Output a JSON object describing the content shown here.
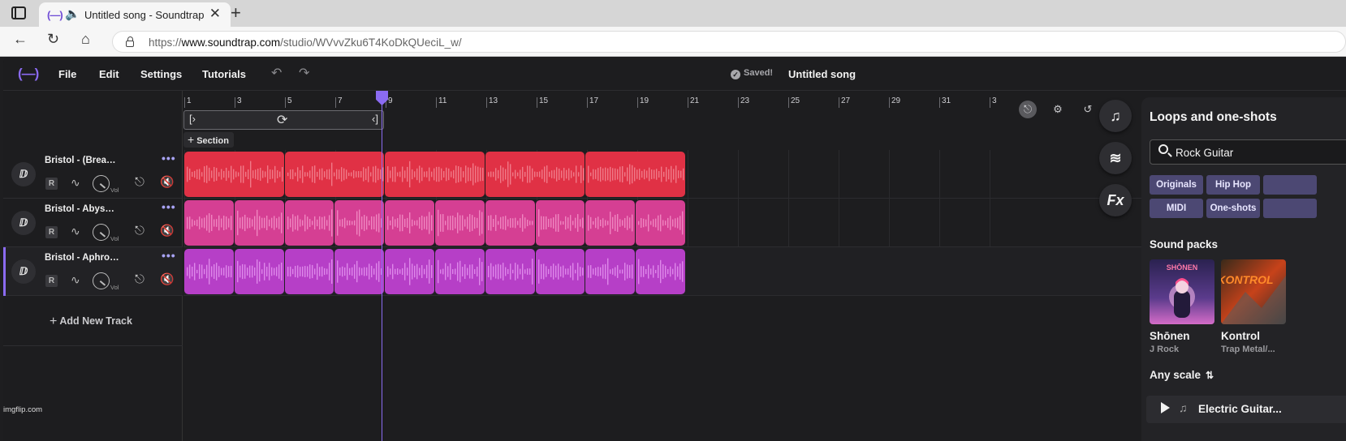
{
  "browser": {
    "tab_title": "Untitled song - Soundtrap",
    "tab_favicon": "(—)",
    "url_prefix": "https://",
    "url_domain": "www.soundtrap.com",
    "url_path": "/studio/WVvvZku6T4KoDkQUeciL_w/",
    "read_aloud": "A⁾"
  },
  "app": {
    "logo": "(—)",
    "menu": [
      "File",
      "Edit",
      "Settings",
      "Tutorials"
    ],
    "saved_label": "Saved!",
    "song_title": "Untitled song"
  },
  "ruler": {
    "bars": [
      "1",
      "3",
      "5",
      "7",
      "9",
      "11",
      "13",
      "15",
      "17",
      "19",
      "21",
      "23",
      "25",
      "27",
      "29",
      "31",
      "3"
    ]
  },
  "section_label": "Section",
  "tracks": [
    {
      "name": "Bristol - (Breakb...",
      "rec": "R",
      "vol": "Vol",
      "color": "#e03145",
      "wave": "#f07a88",
      "clips": 5,
      "selected": false
    },
    {
      "name": "Bristol - Abyss (B...",
      "rec": "R",
      "vol": "Vol",
      "color": "#d53f93",
      "wave": "#ef86c0",
      "clips": 10,
      "selected": false
    },
    {
      "name": "Bristol - Aphrodi...",
      "rec": "R",
      "vol": "Vol",
      "color": "#b63fc7",
      "wave": "#de88ea",
      "clips": 10,
      "selected": true
    }
  ],
  "add_track_label": "Add New Track",
  "fabs": [
    "music-note",
    "collaborators",
    "Fx"
  ],
  "library": {
    "title": "Loops and one-shots",
    "search_value": "Rock Guitar",
    "chips_row1": [
      "Originals",
      "Hip Hop",
      ""
    ],
    "chips_row2": [
      "MIDI",
      "One-shots",
      ""
    ],
    "sound_packs_label": "Sound packs",
    "packs": [
      {
        "name": "Shōnen",
        "genre": "J Rock",
        "cover_text": "SHŌNEN"
      },
      {
        "name": "Kontrol",
        "genre": "Trap Metal/...",
        "cover_text": "KONTROL"
      }
    ],
    "scale_label": "Any scale",
    "loop_name": "Electric Guitar..."
  },
  "watermark": "imgflip.com",
  "colors": {
    "accent": "#8b6bf2",
    "bg": "#1d1d1f"
  }
}
